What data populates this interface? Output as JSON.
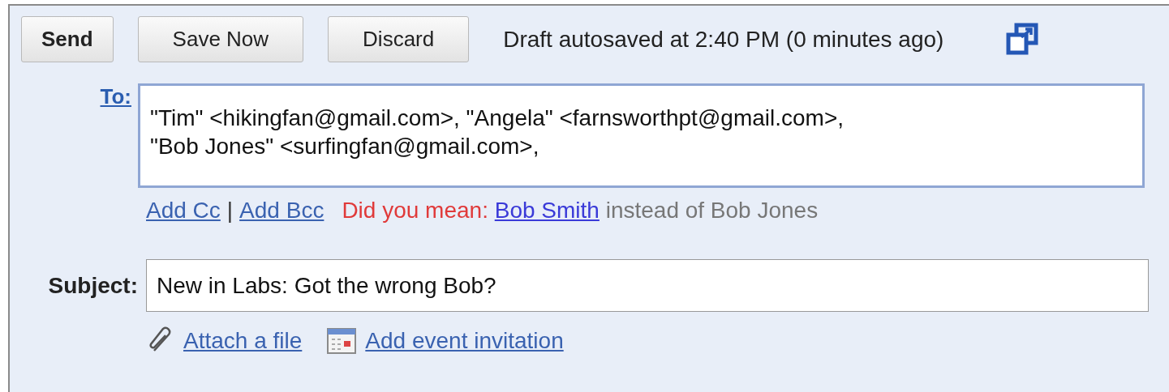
{
  "toolbar": {
    "buttons": [
      {
        "label": "Send",
        "kind": "primary"
      },
      {
        "label": "Save Now",
        "kind": "normal"
      },
      {
        "label": "Discard",
        "kind": "normal"
      }
    ],
    "status": "Draft autosaved at 2:40 PM (0 minutes ago)"
  },
  "to": {
    "label": "To:",
    "lines": [
      "\"Tim\" <hikingfan@gmail.com>, \"Angela\" <farnsworthpt@gmail.com>,",
      "\"Bob Jones\" <surfingfan@gmail.com>,"
    ]
  },
  "recipient_links": {
    "add_cc": "Add Cc",
    "separator": "|",
    "add_bcc": "Add Bcc"
  },
  "suggestion": {
    "prefix": "Did you mean:",
    "link": "Bob Smith",
    "suffix": "instead of Bob Jones"
  },
  "subject": {
    "label": "Subject:",
    "value": "New in Labs: Got the wrong Bob?"
  },
  "attachments": {
    "attach": "Attach a file",
    "event": "Add event invitation"
  }
}
